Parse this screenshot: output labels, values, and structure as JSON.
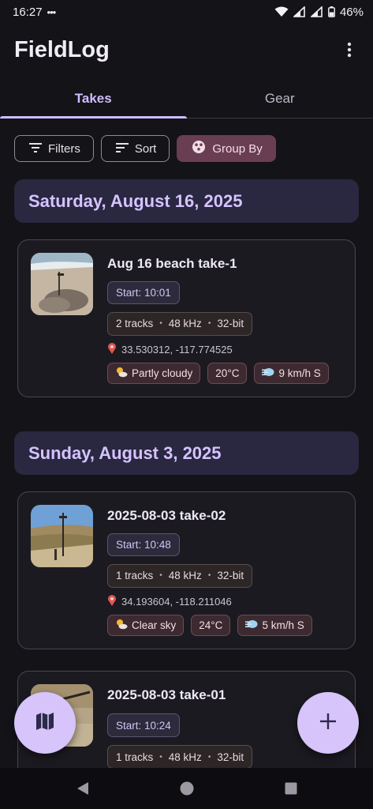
{
  "status_bar": {
    "time": "16:27",
    "dots": "•••",
    "battery": "46%"
  },
  "app": {
    "title": "FieldLog",
    "overflow_icon": "more-vert-icon"
  },
  "tabs": [
    {
      "label": "Takes",
      "active": true
    },
    {
      "label": "Gear",
      "active": false
    }
  ],
  "filters": {
    "filters_label": "Filters",
    "sort_label": "Sort",
    "group_label": "Group By"
  },
  "sections": [
    {
      "date": "Saturday, August 16, 2025",
      "cards": [
        {
          "title": "Aug 16 beach take-1",
          "start": "Start: 10:01",
          "tracks": "2 tracks",
          "rate": "48 kHz",
          "depth": "32-bit",
          "coords": "33.530312, -117.774525",
          "weather": "Partly cloudy",
          "temp": "20°C",
          "wind": "9 km/h S"
        }
      ]
    },
    {
      "date": "Sunday, August 3, 2025",
      "cards": [
        {
          "title": "2025-08-03 take-02",
          "start": "Start: 10:48",
          "tracks": "1 tracks",
          "rate": "48 kHz",
          "depth": "32-bit",
          "coords": "34.193604, -118.211046",
          "weather": "Clear sky",
          "temp": "24°C",
          "wind": "5 km/h S"
        },
        {
          "title": "2025-08-03 take-01",
          "start": "Start: 10:24",
          "tracks": "1 tracks",
          "rate": "48 kHz",
          "depth": "32-bit"
        }
      ]
    }
  ],
  "colors": {
    "accent": "#cfbcff",
    "fab": "#d6c4fb",
    "group_chip": "#6a3e52"
  }
}
